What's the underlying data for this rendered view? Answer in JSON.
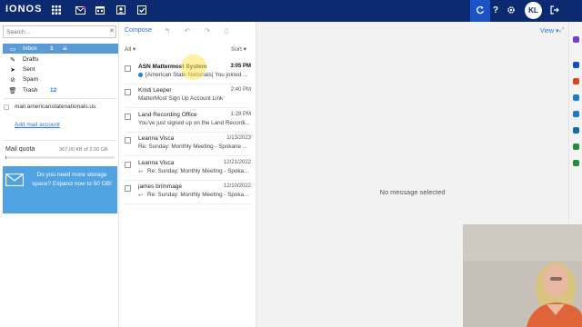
{
  "app": {
    "logo": "IONOS"
  },
  "topbar": {
    "icons": [
      "apps-grid-icon",
      "mail-icon",
      "calendar-icon",
      "contacts-icon",
      "tasks-icon"
    ],
    "right_icons": [
      "sync-icon",
      "help-icon",
      "settings-icon"
    ],
    "avatar_initials": "KL",
    "logout_icon": "logout-icon"
  },
  "sidebar": {
    "search_placeholder": "Search...",
    "folders": [
      {
        "name": "Inbox",
        "count": "1",
        "icon": "inbox-icon",
        "active": true
      },
      {
        "name": "Drafts",
        "count": "",
        "icon": "drafts-icon"
      },
      {
        "name": "Sent",
        "count": "",
        "icon": "sent-icon"
      },
      {
        "name": "Spam",
        "count": "",
        "icon": "spam-icon"
      },
      {
        "name": "Trash",
        "count": "12",
        "icon": "trash-icon"
      }
    ],
    "account": "mail.americanstatenationals.us",
    "add_account": "Add mail account",
    "quota_label": "Mail quota",
    "quota_value": "367.00 KB of 2.00 GB",
    "quota_fraction": 0.0002,
    "promo_text": "Do you need more storage space? Expand now to 50 GB!"
  },
  "list": {
    "compose": "Compose",
    "filter": "All",
    "sort": "Sort",
    "messages": [
      {
        "from": "ASN Mattermost System",
        "date": "3:05 PM",
        "subject": "[American State Nationals] You joined ...",
        "unread": true,
        "marker": "unread-dot"
      },
      {
        "from": "Kristi Leeper",
        "date": "2:40 PM",
        "subject": "MatterMost Sign Up Account Link",
        "unread": false
      },
      {
        "from": "Land Recording Office",
        "date": "1:28 PM",
        "subject": "You've just signed up on the Land Recordi...",
        "unread": false
      },
      {
        "from": "Leanna Visca",
        "date": "1/13/2023",
        "subject": "Re: Sunday: Monthly Meeting - Spokane ...",
        "unread": false
      },
      {
        "from": "Leanna Visca",
        "date": "12/21/2022",
        "subject": "Re: Sunday: Monthly Meeting - Spoka...",
        "unread": false,
        "replied": true
      },
      {
        "from": "james brimmage",
        "date": "12/10/2022",
        "subject": "Re: Sunday: Monthly Meeting - Spoka...",
        "unread": false,
        "replied": true
      }
    ]
  },
  "reading_pane": {
    "view": "View",
    "empty_text": "No message selected"
  },
  "colors": {
    "topbar": "#0b2a6f",
    "active_folder": "#5b9bd5",
    "promo": "#4fa3e3",
    "link": "#2a75d0"
  }
}
